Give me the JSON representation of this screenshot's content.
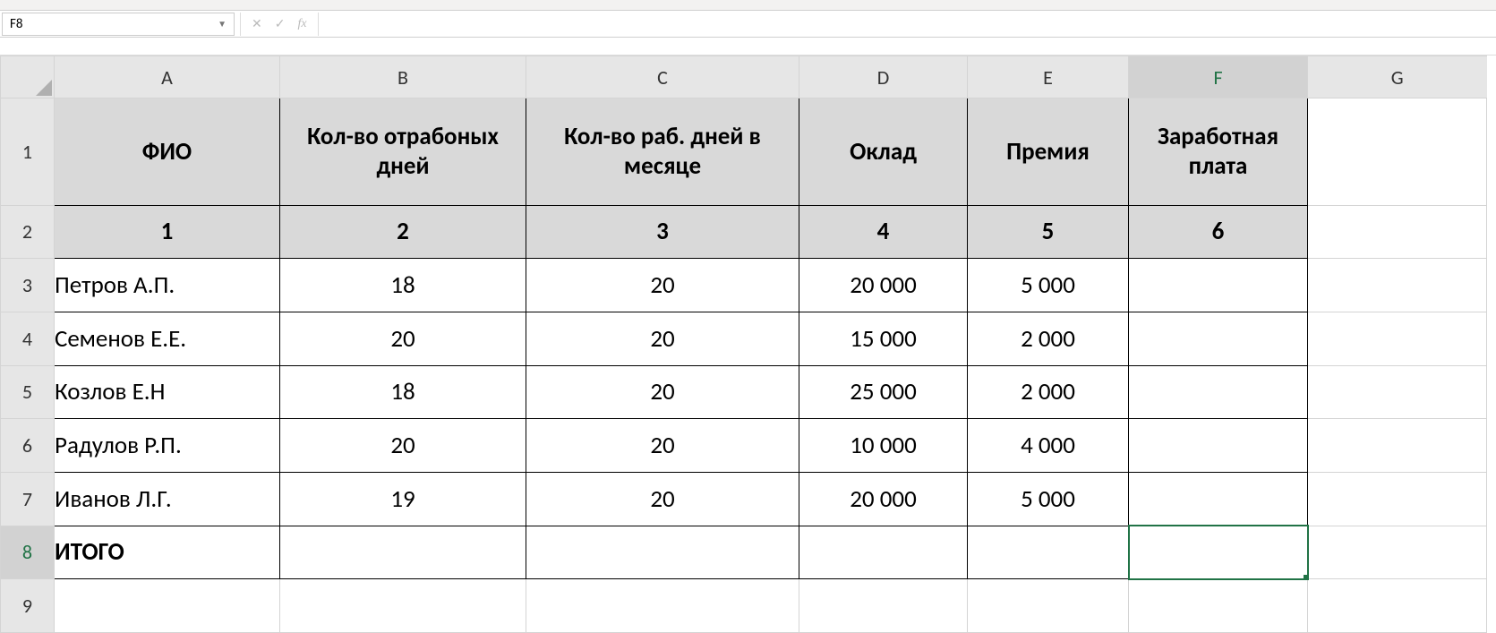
{
  "name_box": "F8",
  "formula_bar": "",
  "columns": [
    "A",
    "B",
    "C",
    "D",
    "E",
    "F",
    "G"
  ],
  "row_numbers": [
    "1",
    "2",
    "3",
    "4",
    "5",
    "6",
    "7",
    "8",
    "9"
  ],
  "selected_cell": "F8",
  "table": {
    "headers_row1": {
      "A": "ФИО",
      "B": "Кол-во отрабоных дней",
      "C": "Кол-во раб. дней в месяце",
      "D": "Оклад",
      "E": "Премия",
      "F": "Заработная плата"
    },
    "headers_row2": {
      "A": "1",
      "B": "2",
      "C": "3",
      "D": "4",
      "E": "5",
      "F": "6"
    },
    "data_rows": [
      {
        "A": "Петров А.П.",
        "B": "18",
        "C": "20",
        "D": "20 000",
        "E": "5 000",
        "F": ""
      },
      {
        "A": "Семенов Е.Е.",
        "B": "20",
        "C": "20",
        "D": "15 000",
        "E": "2 000",
        "F": ""
      },
      {
        "A": "Козлов Е.Н",
        "B": "18",
        "C": "20",
        "D": "25 000",
        "E": "2 000",
        "F": ""
      },
      {
        "A": "Радулов Р.П.",
        "B": "20",
        "C": "20",
        "D": "10 000",
        "E": "4 000",
        "F": ""
      },
      {
        "A": "Иванов Л.Г.",
        "B": "19",
        "C": "20",
        "D": "20 000",
        "E": "5 000",
        "F": ""
      }
    ],
    "totals_row": {
      "A": "ИТОГО",
      "B": "",
      "C": "",
      "D": "",
      "E": "",
      "F": ""
    }
  },
  "icons": {
    "dropdown": "▼",
    "cancel": "✕",
    "enter": "✓",
    "fx": "fx"
  }
}
